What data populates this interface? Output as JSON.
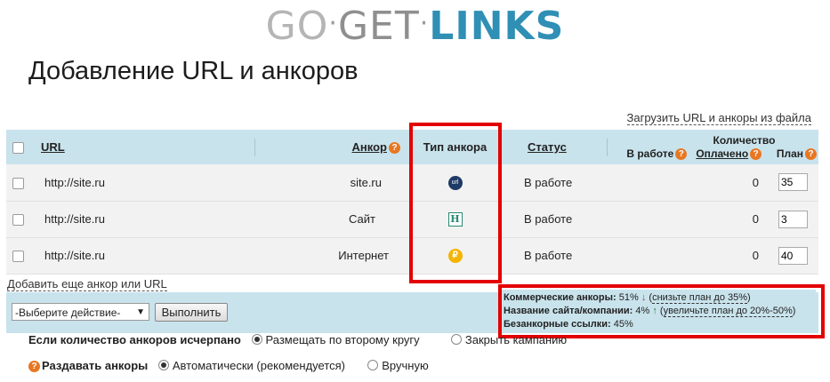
{
  "logo": {
    "part1": "GO",
    "part2": "GET",
    "part3": "LINKS"
  },
  "page_title": "Добавление URL и анкоров",
  "upload_link": "Загрузить URL и анкоры из файла",
  "table": {
    "headers": {
      "url": "URL",
      "anchor": "Анкор",
      "anchor_type": "Тип анкора",
      "status": "Статус",
      "quantity": "Количество",
      "in_work": "В работе",
      "paid": "Оплачено",
      "plan": "План"
    },
    "rows": [
      {
        "url": "http://site.ru",
        "anchor": "site.ru",
        "anchor_type_icon": "url-icon",
        "status": "В работе",
        "paid": "0",
        "plan": "35"
      },
      {
        "url": "http://site.ru",
        "anchor": "Сайт",
        "anchor_type_icon": "h-icon",
        "status": "В работе",
        "paid": "0",
        "plan": "3"
      },
      {
        "url": "http://site.ru",
        "anchor": "Интернет",
        "anchor_type_icon": "ruble-icon",
        "status": "В работе",
        "paid": "0",
        "plan": "40"
      }
    ]
  },
  "add_link": "Добавить еще анкор или URL",
  "action": {
    "select_value": "-Выберите действие-",
    "execute_label": "Выполнить"
  },
  "stats": {
    "commercial_label": "Коммерческие анкоры:",
    "commercial_value": "51%",
    "commercial_arrow": "↓",
    "commercial_action": "снизьте план до 35%",
    "site_name_label": "Название сайта/компании:",
    "site_name_value": "4%",
    "site_name_arrow": "↑",
    "site_name_action": "увеличьте план до 20%-50%",
    "noanchor_label": "Безанкорные ссылки:",
    "noanchor_value": "45%"
  },
  "options": {
    "exhausted_label": "Если количество анкоров исчерпано",
    "exhausted_opt1": "Размещать по второму кругу",
    "exhausted_opt2": "Закрыть кампанию",
    "distribute_label": "Раздавать анкоры",
    "distribute_opt1": "Автоматически (рекомендуется)",
    "distribute_opt2": "Вручную"
  },
  "colors": {
    "accent": "#2f8fb5",
    "header_bg": "#c9e3ec",
    "highlight": "#e30000",
    "help": "#e87722"
  }
}
